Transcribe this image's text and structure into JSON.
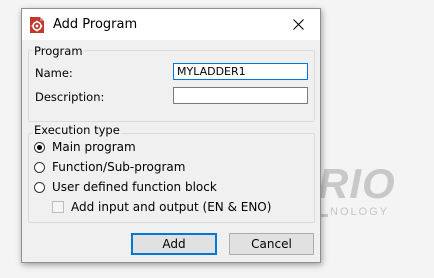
{
  "background": {
    "logo_text": "RIO",
    "logo_subtext": "NOLOGY"
  },
  "dialog": {
    "title": "Add Program",
    "app_icon": "gear-document-icon",
    "close_icon": "close-icon"
  },
  "program_group": {
    "title": "Program",
    "name_label": "Name:",
    "name_value": "MYLADDER1",
    "description_label": "Description:",
    "description_value": ""
  },
  "execution_group": {
    "title": "Execution type",
    "options": [
      {
        "label": "Main program",
        "checked": true
      },
      {
        "label": "Function/Sub-program",
        "checked": false
      },
      {
        "label": "User defined function block",
        "checked": false
      }
    ],
    "checkbox_label": "Add input and output (EN & ENO)",
    "checkbox_checked": false,
    "checkbox_enabled": false
  },
  "buttons": {
    "add": "Add",
    "cancel": "Cancel"
  },
  "colors": {
    "accent": "#0078d7",
    "icon_red": "#c0392b"
  }
}
